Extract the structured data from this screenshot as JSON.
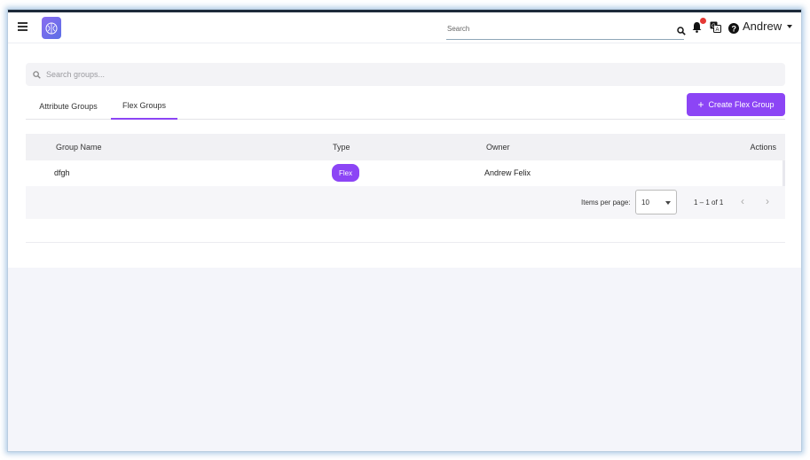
{
  "header": {
    "search_placeholder": "Search",
    "user_name": "Andrew",
    "icons": [
      "menu-icon",
      "brain-logo",
      "search-icon",
      "bell-icon",
      "translate-icon",
      "help-icon",
      "caret-down-icon"
    ],
    "notification_dot_color": "#e53935"
  },
  "groups": {
    "search_placeholder": "Search groups...",
    "tabs": [
      {
        "label": "Attribute Groups",
        "active": false
      },
      {
        "label": "Flex Groups",
        "active": true
      }
    ],
    "create_button_label": "Create Flex Group",
    "accent_color": "#8c45f5"
  },
  "table": {
    "columns": [
      "Group Name",
      "Type",
      "Owner",
      "Actions"
    ],
    "rows": [
      {
        "group_name": "dfgh",
        "type": "Flex",
        "owner": "Andrew Felix"
      }
    ],
    "paginator": {
      "items_per_page_label": "Items per page:",
      "items_per_page_value": "10",
      "range_label": "1 – 1 of 1"
    }
  }
}
